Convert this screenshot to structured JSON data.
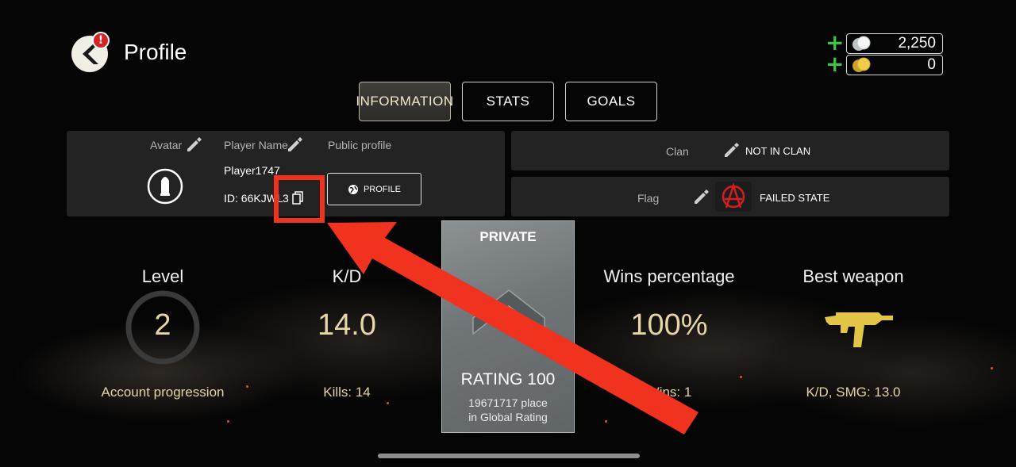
{
  "header": {
    "title": "Profile",
    "alert_badge": "!"
  },
  "currency": [
    {
      "amount": "2,250",
      "icon": "silver-coins-icon"
    },
    {
      "amount": "0",
      "icon": "gold-coins-icon"
    }
  ],
  "tabs": [
    {
      "label": "INFORMATION",
      "active": true
    },
    {
      "label": "STATS",
      "active": false
    },
    {
      "label": "GOALS",
      "active": false
    }
  ],
  "profile_panel": {
    "avatar_label": "Avatar",
    "player_name_label": "Player Name",
    "public_profile_label": "Public profile",
    "player_name": "Player1747",
    "id_text": "ID: 66KJWL",
    "id_tail": "3",
    "profile_button": "PROFILE"
  },
  "clan_panel": {
    "label": "Clan",
    "value": "NOT IN CLAN"
  },
  "flag_panel": {
    "label": "Flag",
    "value": "FAILED STATE"
  },
  "stats": {
    "level": {
      "title": "Level",
      "value": "2",
      "sub": "Account progression"
    },
    "kd": {
      "title": "K/D",
      "value": "14.0",
      "sub": "Kills: 14"
    },
    "wins": {
      "title": "Wins percentage",
      "value": "100%",
      "sub": "Wins: 1"
    },
    "weapon": {
      "title": "Best weapon",
      "sub": "K/D, SMG: 13.0"
    }
  },
  "rank_card": {
    "rank": "PRIVATE",
    "rating": "RATING 100",
    "place": "19671717 place",
    "place_sub": "in Global Rating"
  },
  "colors": {
    "accent_gold": "#e6d5a6",
    "highlight_red": "#f0321e",
    "plus_green": "#3fc14a"
  }
}
